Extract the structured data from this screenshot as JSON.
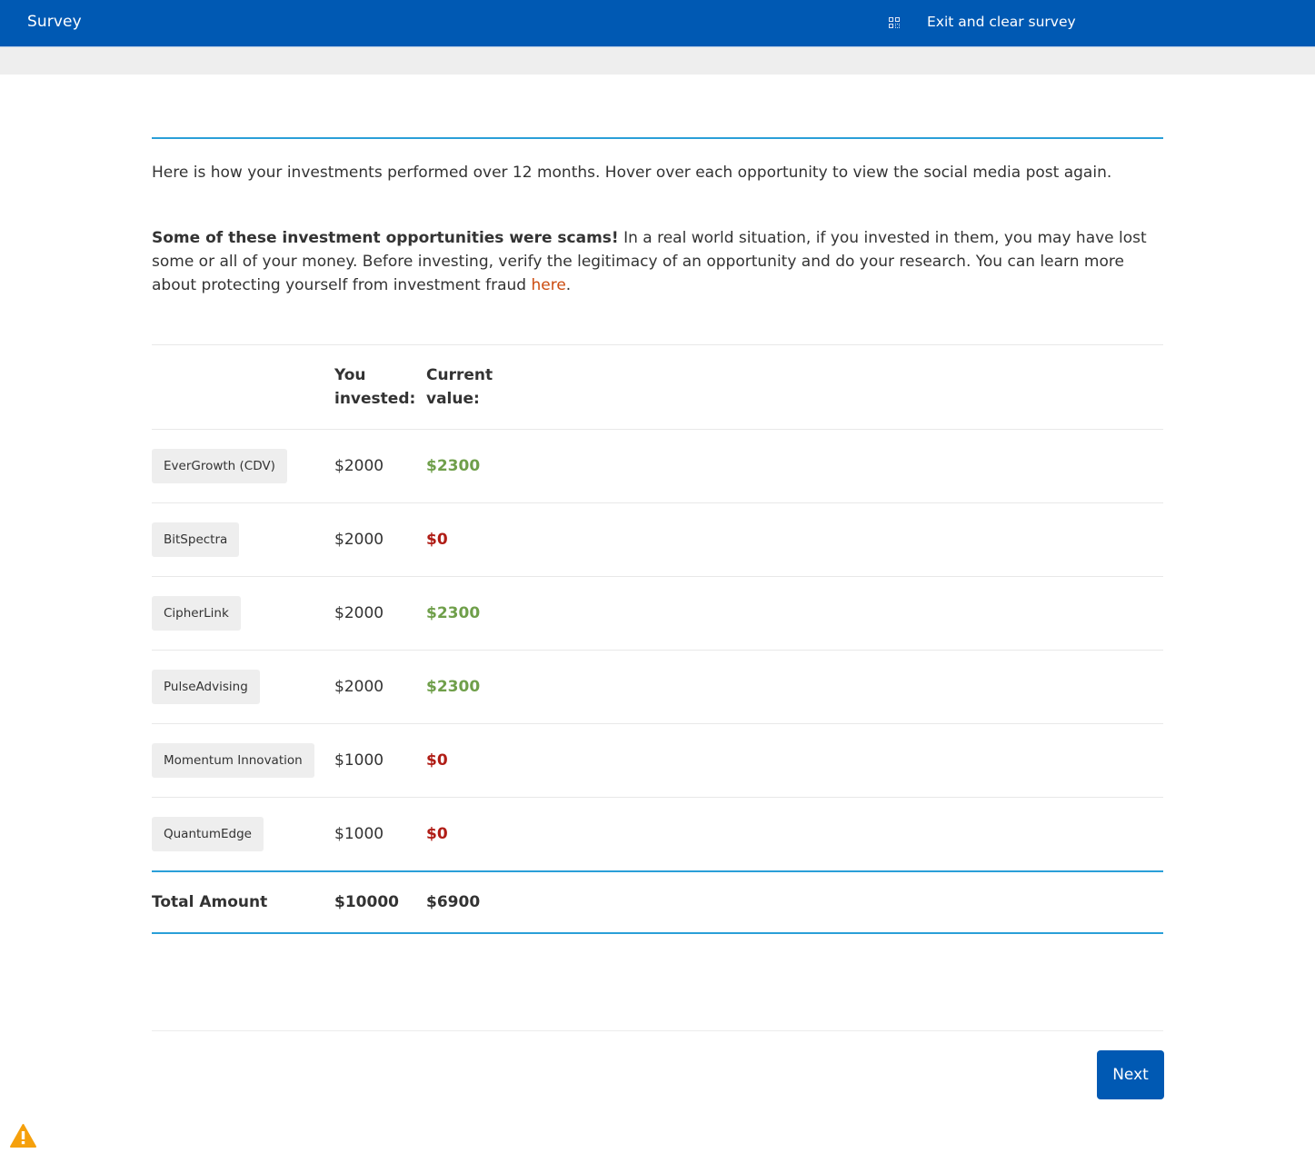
{
  "header": {
    "title": "Survey",
    "exit_icon": "qr-code-icon",
    "exit_label": "Exit and clear survey",
    "color": "#0059b3"
  },
  "intro": "Here is how your investments performed over 12 months. Hover over each opportunity to view the social media post again.",
  "warning": {
    "bold": "Some of these investment opportunities were scams!",
    "text": " In a real world situation, if you invested in them, you may have lost some or all of your money. Before investing, verify the legitimacy of an opportunity and do your research. You can learn more about protecting yourself from investment fraud ",
    "link_label": "here",
    "tail": ".",
    "link_color": "#cc4b0e"
  },
  "table": {
    "headers": {
      "name": "",
      "invested": "You invested:",
      "current": "Current value:"
    },
    "rows": [
      {
        "name": "EverGrowth (CDV)",
        "invested": "$2000",
        "current": "$2300",
        "status": "gain"
      },
      {
        "name": "BitSpectra",
        "invested": "$2000",
        "current": "$0",
        "status": "loss"
      },
      {
        "name": "CipherLink",
        "invested": "$2000",
        "current": "$2300",
        "status": "gain"
      },
      {
        "name": "PulseAdvising",
        "invested": "$2000",
        "current": "$2300",
        "status": "gain"
      },
      {
        "name": "Momentum Innovation",
        "invested": "$1000",
        "current": "$0",
        "status": "loss"
      },
      {
        "name": "QuantumEdge",
        "invested": "$1000",
        "current": "$0",
        "status": "loss"
      }
    ],
    "total": {
      "label": "Total Amount",
      "invested": "$10000",
      "current": "$6900"
    },
    "colors": {
      "gain": "#6f9f4a",
      "loss": "#b01d16"
    }
  },
  "footer": {
    "next_label": "Next",
    "alert_icon": "warning-triangle-icon",
    "alert_color": "#f5a00c"
  }
}
